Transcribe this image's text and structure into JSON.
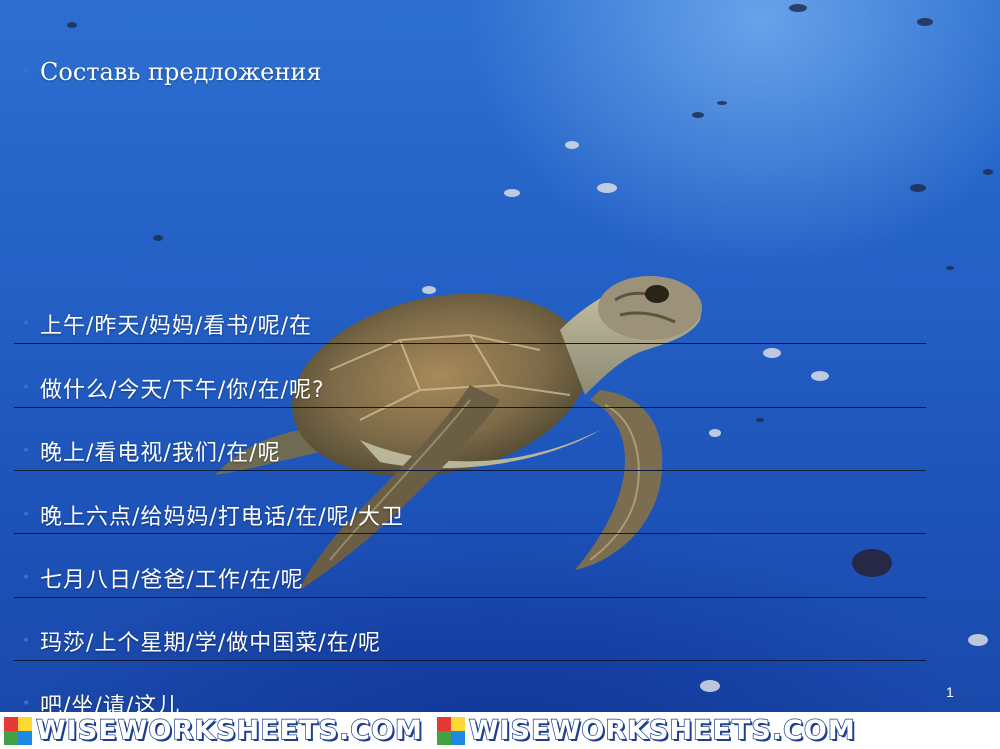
{
  "slide": {
    "title": "Составь предложения",
    "items": [
      "上午/昨天/妈妈/看书/呢/在",
      "做什么/今天/下午/你/在/呢?",
      "晚上/看电视/我们/在/呢",
      "晚上六点/给妈妈/打电话/在/呢/大卫",
      "七月八日/爸爸/工作/在/呢",
      "玛莎/上个星期/学/做中国菜/在/呢",
      "吧/坐/请/这儿"
    ],
    "page_number": "1"
  },
  "footer": {
    "watermark": "WISEWORKSHEETS.COM"
  },
  "colors": {
    "ocean": "#2461c6",
    "bullet": "#2a78d6",
    "text": "#ffffff",
    "rule": "#0a1a3a"
  }
}
